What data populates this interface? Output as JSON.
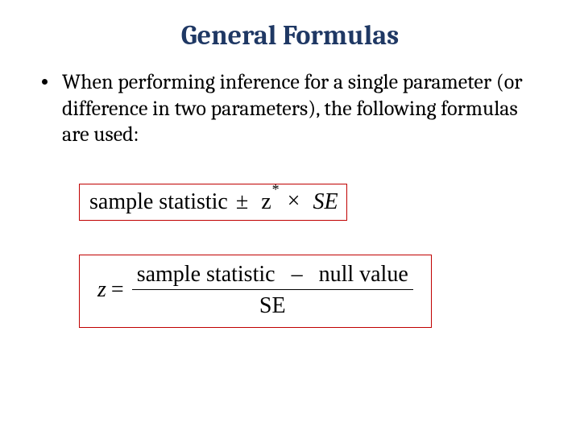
{
  "title": "General Formulas",
  "bullet": "When performing inference for a single parameter (or difference in two parameters), the following formulas are used:",
  "formula1": {
    "text": "sample statistic",
    "pm": "±",
    "z": "z",
    "star": "*",
    "times": "×",
    "se": "SE"
  },
  "formula2": {
    "z": "z",
    "eq": "=",
    "num_left": "sample statistic",
    "minus": "–",
    "num_right": "null value",
    "den": "SE"
  }
}
